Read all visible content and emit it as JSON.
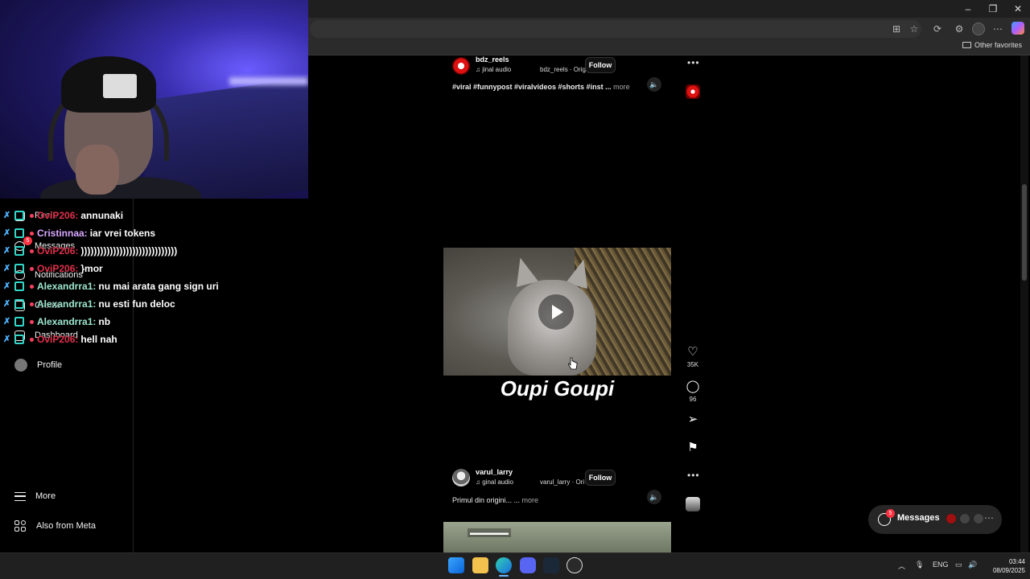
{
  "browser": {
    "favorites_other_label": "Other favorites",
    "window_controls": {
      "minimize": "–",
      "restore": "❐",
      "close": "✕"
    }
  },
  "sidebar": {
    "items": [
      {
        "label": "Reels",
        "icon": "reels-icon"
      },
      {
        "label": "Messages",
        "icon": "messages-icon",
        "badge": "5"
      },
      {
        "label": "Notifications",
        "icon": "heart-icon"
      },
      {
        "label": "Create",
        "icon": "plus-square-icon"
      },
      {
        "label": "Dashboard",
        "icon": "dashboard-icon"
      },
      {
        "label": "Profile",
        "icon": "profile-avatar"
      },
      {
        "label": "More",
        "icon": "hamburger-icon"
      },
      {
        "label": "Also from Meta",
        "icon": "meta-grid-icon"
      }
    ]
  },
  "chat": {
    "messages": [
      {
        "user": "OviP206:",
        "text": "annunaki",
        "color": "#e0304a"
      },
      {
        "user": "Cristinnaa:",
        "text": "iar vrei tokens",
        "color": "#d9a8ff"
      },
      {
        "user": "OviP206:",
        "text": "))))))))))))))))))))))))))))))",
        "color": "#e0304a"
      },
      {
        "user": "OviP206:",
        "text": "}mor",
        "color": "#e0304a"
      },
      {
        "user": "Alexandrra1:",
        "text": "nu mai arata gang sign uri",
        "color": "#9ee6d0"
      },
      {
        "user": "Alexandrra1:",
        "text": "nu esti fun deloc",
        "color": "#9ee6d0"
      },
      {
        "user": "Alexandrra1:",
        "text": "nb",
        "color": "#9ee6d0"
      },
      {
        "user": "OviP206:",
        "text": "hell nah",
        "color": "#e0304a"
      }
    ]
  },
  "reel1": {
    "username": "bdz_reels",
    "audio": "♫ jinal audio",
    "audio_source": "bdz_reels · Orig",
    "follow": "Follow",
    "caption": "#viral #funnypost #viralvideos #shorts #inst ...",
    "more": "more",
    "title": "Oupi Goupi",
    "likes": "35K",
    "comments": "96"
  },
  "reel2": {
    "username": "varul_larry",
    "audio": "♫ ginal audio",
    "audio_source": "varul_larry · Ori",
    "follow": "Follow",
    "caption": "Primul din origini... ...",
    "more": "more"
  },
  "messages_pill": {
    "label": "Messages",
    "badge": "5"
  },
  "taskbar": {
    "lang": "ENG",
    "time": "03:44",
    "date": "08/09/2025"
  },
  "colors": {
    "accent": "#0095f6",
    "badge": "#ff3040",
    "background": "#000000"
  }
}
